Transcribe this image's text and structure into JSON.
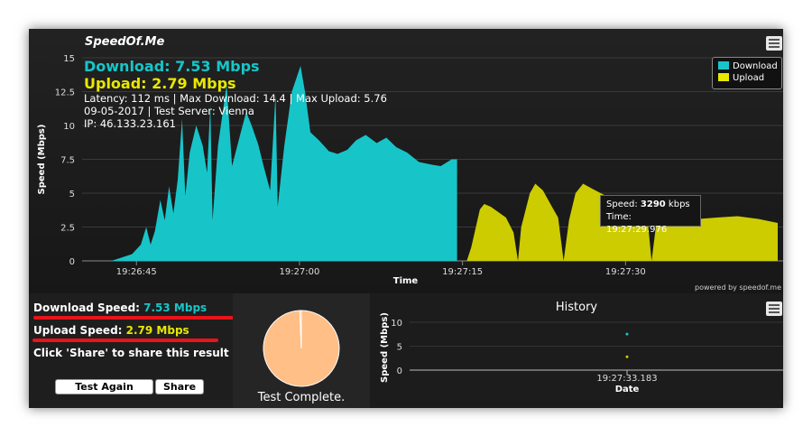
{
  "app": {
    "brand": "SpeedOf.Me",
    "powered_by": "powered by speedof.me"
  },
  "stats": {
    "download_label": "Download: ",
    "download_value": "7.53 Mbps",
    "upload_label": "Upload: ",
    "upload_value": "2.79 Mbps",
    "line1": "Latency: 112 ms | Max Download: 14.4 | Max Upload: 5.76",
    "line2": "09-05-2017 | Test Server: Vienna",
    "line3": "IP: 46.133.23.161"
  },
  "legend": {
    "items": [
      {
        "label": "Download",
        "color": "#17c5c9"
      },
      {
        "label": "Upload",
        "color": "#cccc00"
      }
    ]
  },
  "tooltip": {
    "speed_label": "Speed: ",
    "speed_value": "3290",
    "speed_unit": " kbps",
    "time_label": "Time: ",
    "time_value": "19:27:29.976"
  },
  "summary": {
    "download_label": "Download Speed: ",
    "download_value": "7.53 Mbps",
    "upload_label": "Upload Speed: ",
    "upload_value": "2.79 Mbps",
    "share_hint": "Click 'Share' to share this result",
    "test_again": "Test Again",
    "share": "Share",
    "status": "Test Complete."
  },
  "history": {
    "title": "History"
  },
  "colors": {
    "download": "#17c5c9",
    "upload": "#cccc00",
    "pie": "#ffbf86",
    "red": "#e8141a"
  },
  "chart_data": [
    {
      "type": "area",
      "xlabel": "Time",
      "ylabel": "Speed (Mbps)",
      "ylim": [
        0,
        15
      ],
      "x_ticks": [
        "19:26:45",
        "19:27:00",
        "19:27:15",
        "19:27:30"
      ],
      "y_ticks": [
        "0",
        "2.5",
        "5",
        "7.5",
        "10",
        "12.5",
        "15"
      ],
      "series": [
        {
          "name": "Download",
          "points": [
            [
              42.7,
              0
            ],
            [
              44.6,
              0.5
            ],
            [
              45.4,
              1.2
            ],
            [
              45.9,
              2.5
            ],
            [
              46.3,
              1.2
            ],
            [
              46.7,
              2.2
            ],
            [
              47.2,
              4.5
            ],
            [
              47.6,
              3.0
            ],
            [
              48.0,
              5.5
            ],
            [
              48.4,
              3.5
            ],
            [
              48.8,
              6.0
            ],
            [
              49.2,
              10.5
            ],
            [
              49.5,
              4.8
            ],
            [
              49.9,
              8.0
            ],
            [
              50.5,
              10.0
            ],
            [
              51.1,
              8.5
            ],
            [
              51.5,
              6.5
            ],
            [
              51.8,
              11.5
            ],
            [
              52.0,
              3.0
            ],
            [
              52.5,
              8.5
            ],
            [
              53.3,
              13.0
            ],
            [
              53.8,
              7.0
            ],
            [
              54.6,
              9.5
            ],
            [
              55.1,
              11.0
            ],
            [
              55.6,
              10.0
            ],
            [
              56.2,
              8.6
            ],
            [
              56.7,
              7.0
            ],
            [
              57.3,
              5.2
            ],
            [
              57.5,
              8.0
            ],
            [
              57.8,
              12.3
            ],
            [
              58.0,
              4.0
            ],
            [
              58.6,
              8.5
            ],
            [
              59.3,
              12.5
            ],
            [
              60.1,
              14.4
            ],
            [
              60.5,
              12.5
            ],
            [
              61.0,
              9.5
            ],
            [
              61.8,
              8.9
            ],
            [
              62.7,
              8.1
            ],
            [
              63.5,
              7.9
            ],
            [
              64.4,
              8.2
            ],
            [
              65.2,
              8.9
            ],
            [
              66.1,
              9.3
            ],
            [
              67.1,
              8.7
            ],
            [
              68.0,
              9.1
            ],
            [
              68.9,
              8.4
            ],
            [
              69.9,
              8.0
            ],
            [
              71.0,
              7.3
            ],
            [
              72.2,
              7.1
            ],
            [
              73.0,
              7.0
            ],
            [
              74.0,
              7.5
            ],
            [
              74.5,
              7.5
            ],
            [
              74.5,
              0
            ]
          ]
        },
        {
          "name": "Upload",
          "points": [
            [
              75.4,
              0
            ],
            [
              75.8,
              1.0
            ],
            [
              76.6,
              3.8
            ],
            [
              77.0,
              4.2
            ],
            [
              77.6,
              4.0
            ],
            [
              79.0,
              3.2
            ],
            [
              79.7,
              2.1
            ],
            [
              80.1,
              0
            ],
            [
              80.4,
              2.5
            ],
            [
              81.2,
              5.0
            ],
            [
              81.7,
              5.7
            ],
            [
              82.4,
              5.2
            ],
            [
              83.3,
              3.9
            ],
            [
              83.8,
              3.2
            ],
            [
              84.3,
              0
            ],
            [
              84.8,
              3.0
            ],
            [
              85.4,
              5.0
            ],
            [
              86.1,
              5.7
            ],
            [
              87.0,
              5.3
            ],
            [
              88.2,
              4.8
            ],
            [
              89.9,
              4.3
            ],
            [
              91.4,
              3.6
            ],
            [
              92.0,
              3.3
            ],
            [
              92.4,
              0
            ],
            [
              92.8,
              2.6
            ],
            [
              93.8,
              3.3
            ],
            [
              95.6,
              3.3
            ],
            [
              96.8,
              3.1
            ],
            [
              98.4,
              3.2
            ],
            [
              100.3,
              3.3
            ],
            [
              102.2,
              3.1
            ],
            [
              104.0,
              2.8
            ],
            [
              104.0,
              0
            ]
          ]
        }
      ]
    },
    {
      "type": "pie",
      "slices": [
        {
          "label": "Download",
          "value": 7.53
        },
        {
          "label": "Upload",
          "value": 0.05
        }
      ]
    },
    {
      "type": "scatter",
      "title": "History",
      "xlabel": "Date",
      "ylabel": "Speed (Mbps)",
      "ylim": [
        0,
        10
      ],
      "y_ticks": [
        "0",
        "5",
        "10"
      ],
      "x_ticks": [
        "19:27:33.183"
      ],
      "series": [
        {
          "name": "Download",
          "points": [
            [
              0,
              7.53
            ]
          ]
        },
        {
          "name": "Upload",
          "points": [
            [
              0,
              2.79
            ]
          ]
        }
      ]
    }
  ]
}
